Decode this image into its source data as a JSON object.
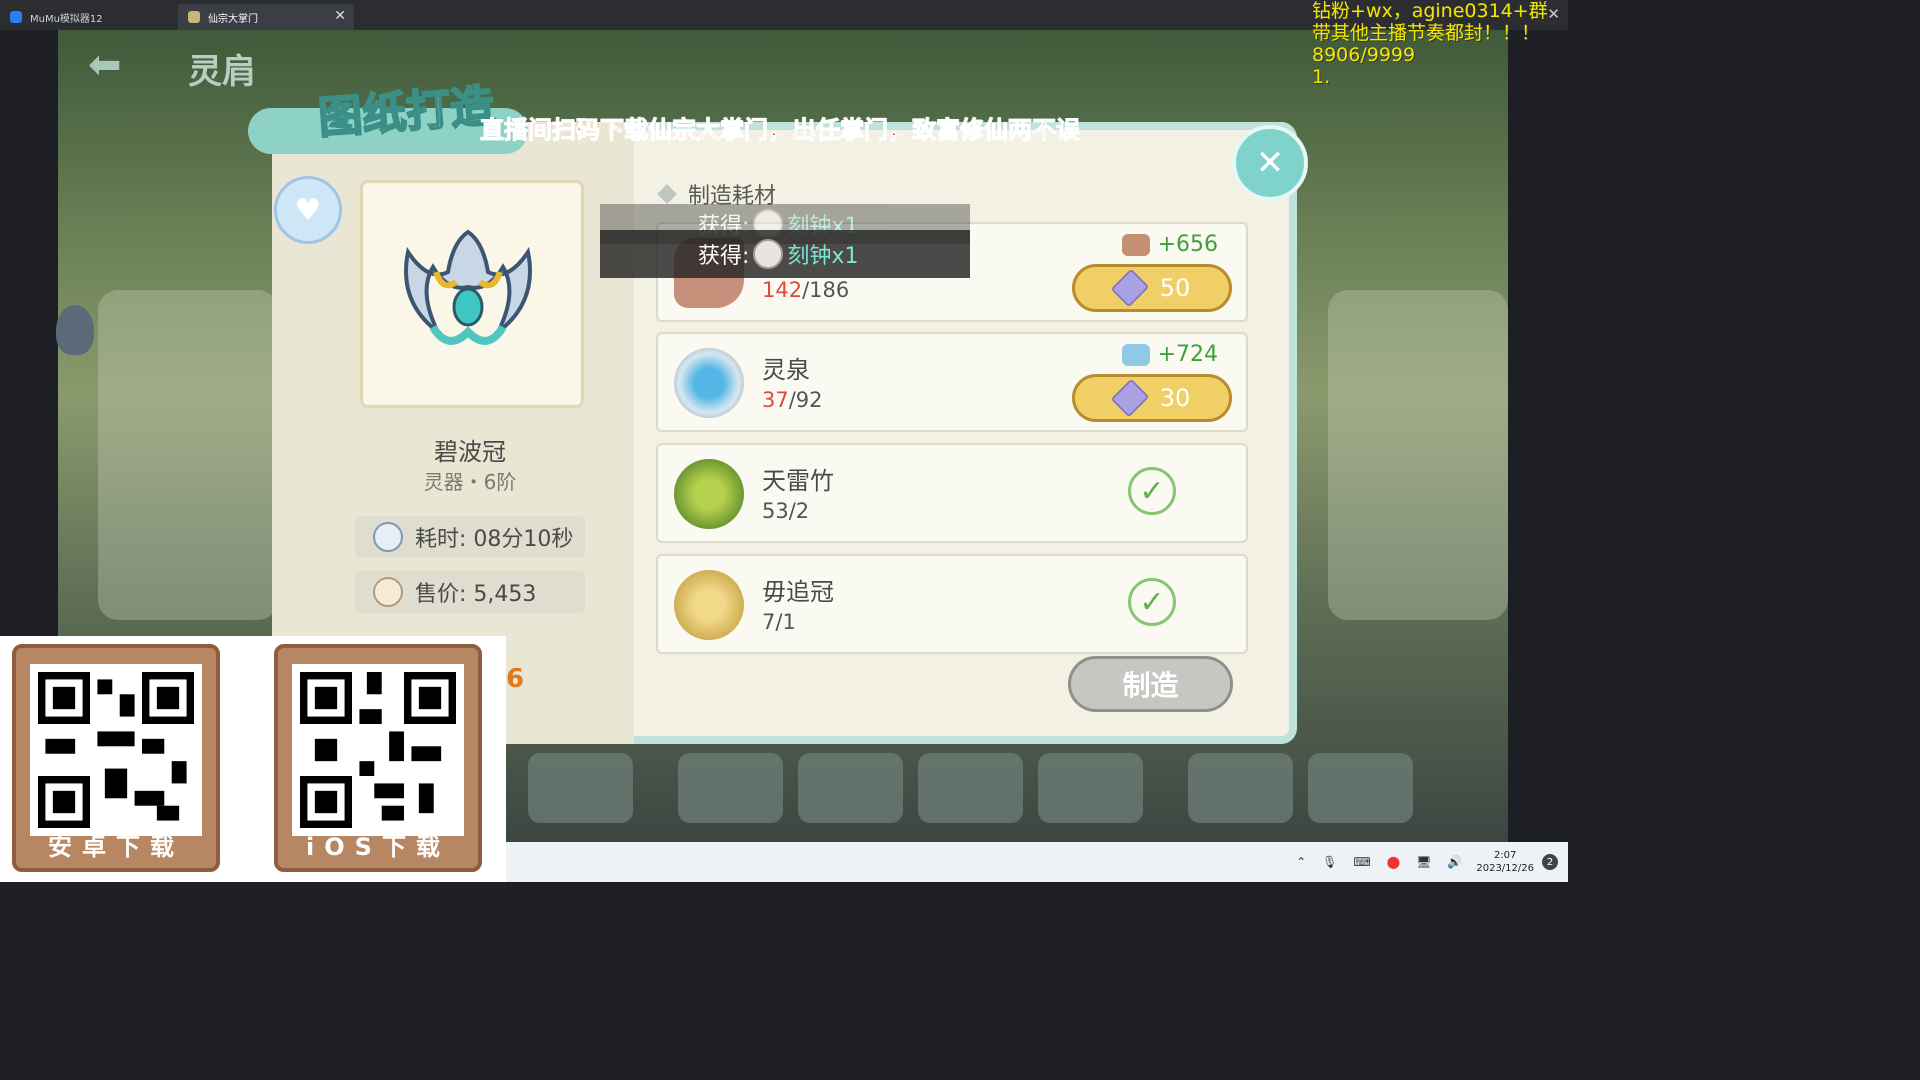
{
  "tabs": [
    {
      "label": "MuMu模拟器12"
    },
    {
      "label": "仙宗大掌门"
    }
  ],
  "game": {
    "back_title": "灵肩",
    "dialog_title": "图纸打造",
    "banner": "直播间扫码下载仙宗大掌门，出任掌门，致富修仙两不误",
    "item": {
      "name": "碧波冠",
      "rank": "灵器・6阶",
      "time_label": "耗时: 08分10秒",
      "price_label": "售价: 5,453"
    },
    "materials_header": "制造耗材",
    "toast": {
      "prefix": "获得:",
      "item": "刻钟x1"
    },
    "materials": [
      {
        "name": "",
        "have": "142",
        "need": "/186",
        "bonus": "+656",
        "cost": "50",
        "status": "buy"
      },
      {
        "name": "灵泉",
        "have": "37",
        "need": "/92",
        "bonus": "+724",
        "cost": "30",
        "status": "buy"
      },
      {
        "name": "天雷竹",
        "have": "53",
        "need": "/2",
        "status": "ok"
      },
      {
        "name": "毋追冠",
        "have": "7",
        "need": "/1",
        "status": "ok"
      }
    ],
    "craft_label": "制造",
    "orange_number": "6"
  },
  "overlay": {
    "line1": "钻粉+wx，agine0314+群",
    "line2": "带其他主播节奏都封！！！",
    "line3": "8906/9999",
    "line4": "1."
  },
  "qr": {
    "android": "安卓下载",
    "ios": "iOS下载"
  },
  "taskbar": {
    "time": "2:07",
    "date": "2023/12/26",
    "notifications": "2"
  }
}
